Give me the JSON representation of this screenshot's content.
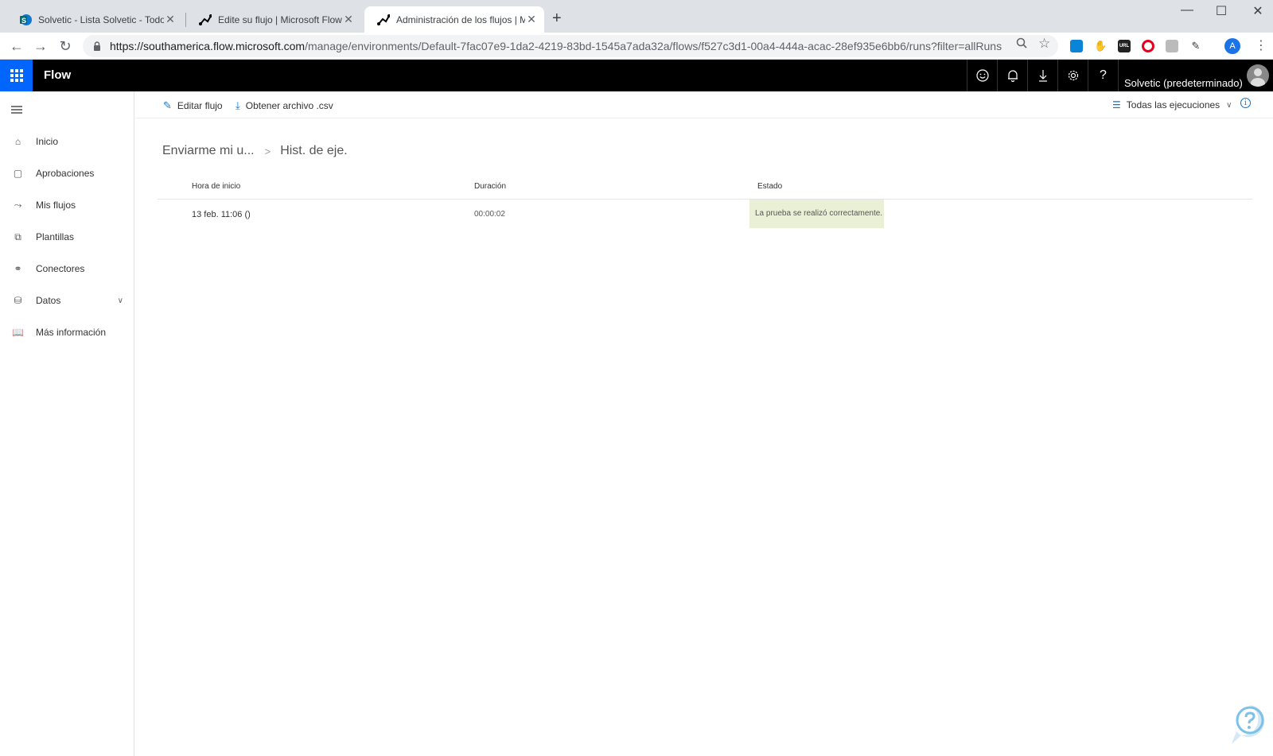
{
  "browser": {
    "tabs": [
      {
        "title": "Solvetic - Lista Solvetic - Todos lo",
        "active": false,
        "icon": "sharepoint-icon"
      },
      {
        "title": "Edite su flujo | Microsoft Flow",
        "active": false,
        "icon": "flow-icon"
      },
      {
        "title": "Administración de los flujos | Mic",
        "active": true,
        "icon": "flow-icon"
      }
    ],
    "url_host": "https://southamerica.flow.microsoft.com",
    "url_path": "/manage/environments/Default-7fac07e9-1da2-4219-83bd-1545a7ada32a/flows/f527c3d1-00a4-444a-acac-28ef935e6bb6/runs?filter=allRuns",
    "profile_initial": "A",
    "extension_url_label": "URL"
  },
  "app": {
    "brand": "Flow",
    "environment": "Solvetic (predeterminado)",
    "accent": "#0066ff"
  },
  "nav": {
    "items": [
      {
        "label": "Inicio",
        "icon": "home-icon"
      },
      {
        "label": "Aprobaciones",
        "icon": "approvals-icon"
      },
      {
        "label": "Mis flujos",
        "icon": "flows-icon"
      },
      {
        "label": "Plantillas",
        "icon": "templates-icon"
      },
      {
        "label": "Conectores",
        "icon": "connectors-icon"
      },
      {
        "label": "Datos",
        "icon": "database-icon"
      },
      {
        "label": "Más información",
        "icon": "book-icon"
      }
    ]
  },
  "commands": {
    "edit": "Editar flujo",
    "csv": "Obtener archivo .csv",
    "filter": "Todas las ejecuciones",
    "info_symbol": "i"
  },
  "breadcrumb": {
    "parent": "Enviarme mi u...",
    "current": "Hist. de eje."
  },
  "runs": {
    "headers": [
      "Hora de inicio",
      "Duración",
      "Estado"
    ],
    "rows": [
      {
        "start": "13 feb. 11:06 ()",
        "duration": "00:00:02",
        "status": "La prueba se realizó correctamente."
      }
    ],
    "status_success_color": "#eaf0d5"
  }
}
